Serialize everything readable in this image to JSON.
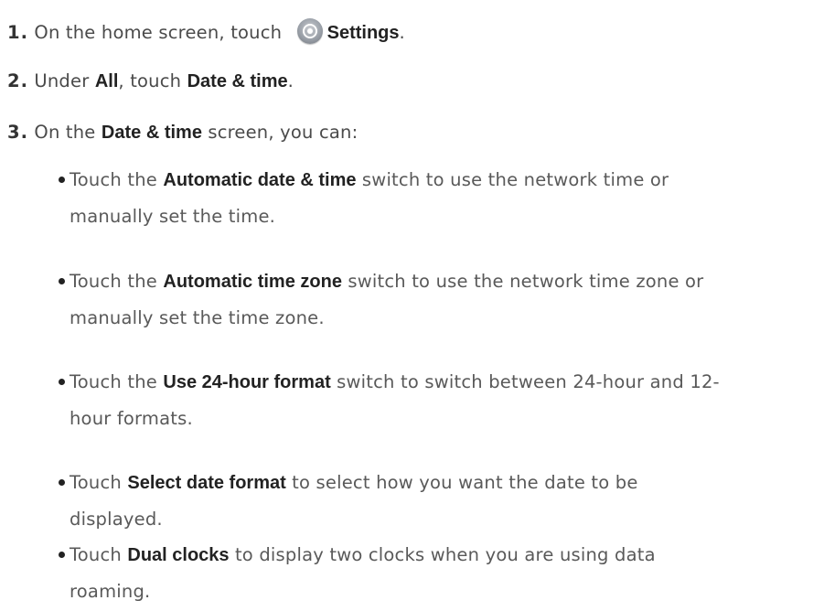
{
  "steps": [
    {
      "num": "1.",
      "before": "On the home screen, touch",
      "bold": "Settings",
      "after": "."
    },
    {
      "num": "2.",
      "t1": "Under ",
      "b1": "All",
      "t2": ", touch ",
      "b2": "Date & time",
      "t3": "."
    },
    {
      "num": "3.",
      "t1": "On the ",
      "b1": "Date & time",
      "t2": " screen, you can:"
    }
  ],
  "bullets": [
    {
      "pre": "Touch the ",
      "bold": "Automatic date & time",
      "post": " switch to use the network time or",
      "cont": "manually set the time."
    },
    {
      "pre": "Touch the ",
      "bold": "Automatic time zone",
      "post": " switch to use the network time zone or",
      "cont": "manually set the time zone."
    },
    {
      "pre": "Touch the ",
      "bold": "Use 24-hour format",
      "post": " switch to switch between 24-hour and 12-",
      "cont": "hour formats."
    },
    {
      "pre": "Touch ",
      "bold": "Select date format",
      "post": " to select how you want the date to be",
      "cont": "displayed."
    },
    {
      "pre": "Touch ",
      "bold": "Dual clocks",
      "post": " to display two clocks when you are using data",
      "cont": "roaming."
    }
  ],
  "icons": {
    "settings": "settings-gear-icon"
  }
}
